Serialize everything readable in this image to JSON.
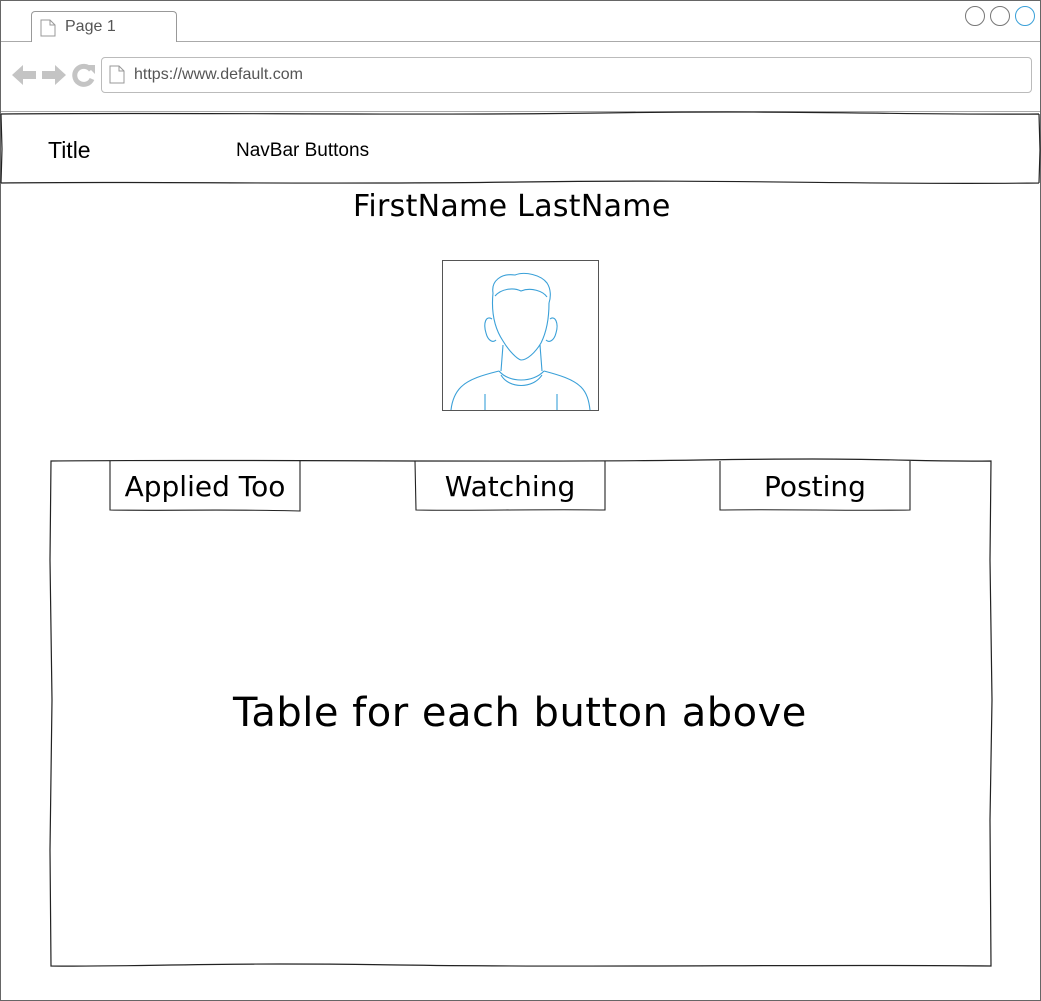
{
  "browser": {
    "tab_label": "Page 1",
    "url": "https://www.default.com"
  },
  "header": {
    "title": "Title",
    "nav_label": "NavBar Buttons"
  },
  "profile": {
    "name": "FirstName LastName"
  },
  "tabs": [
    {
      "label": "Applied Too"
    },
    {
      "label": "Watching"
    },
    {
      "label": "Posting"
    }
  ],
  "content": {
    "placeholder": "Table for each button above"
  },
  "colors": {
    "accent": "#3aa0d8",
    "icon_gray": "#c4c4c4"
  }
}
